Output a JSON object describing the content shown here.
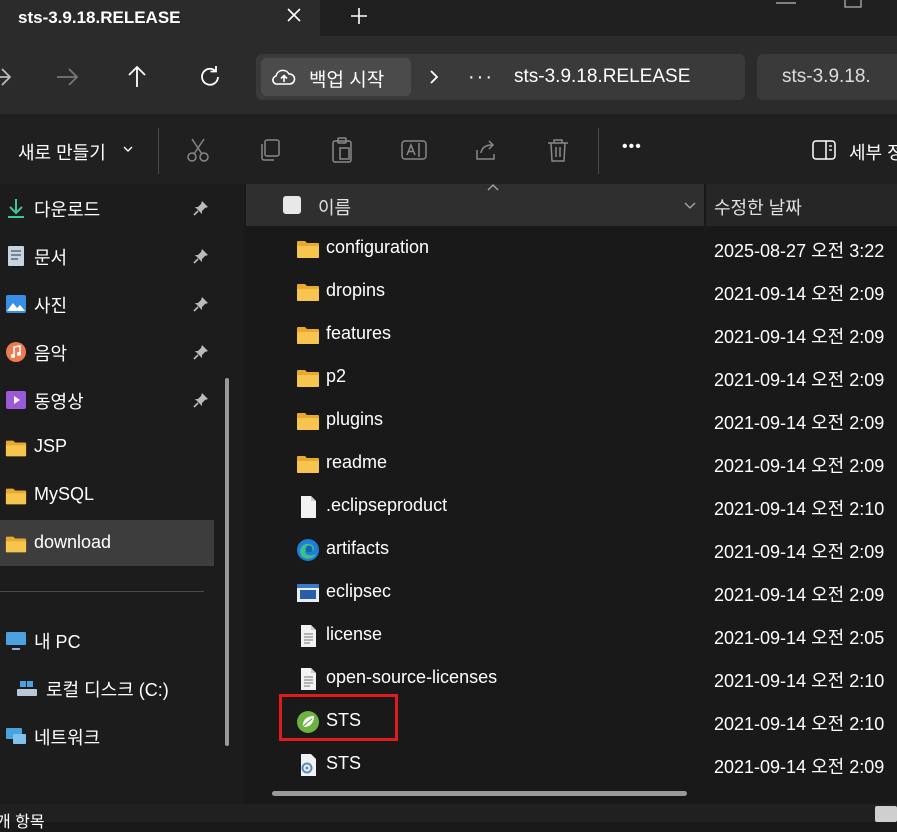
{
  "tab": {
    "title": "sts-3.9.18.RELEASE"
  },
  "address": {
    "backup_label": "백업 시작",
    "more": "···",
    "crumb": "sts-3.9.18.RELEASE",
    "search_placeholder": "sts-3.9.18."
  },
  "toolbar": {
    "new_label": "새로 만들기",
    "more": "•••",
    "details_label": "세부 정"
  },
  "nav": {
    "items": [
      {
        "label": "다운로드",
        "icon": "download-arrow-icon",
        "pinned": true
      },
      {
        "label": "문서",
        "icon": "document-icon",
        "pinned": true
      },
      {
        "label": "사진",
        "icon": "pictures-icon",
        "pinned": true
      },
      {
        "label": "음악",
        "icon": "music-icon",
        "pinned": true
      },
      {
        "label": "동영상",
        "icon": "video-icon",
        "pinned": true
      },
      {
        "label": "JSP",
        "icon": "folder-icon",
        "pinned": false
      },
      {
        "label": "MySQL",
        "icon": "folder-icon",
        "pinned": false
      },
      {
        "label": "download",
        "icon": "folder-icon",
        "pinned": false,
        "selected": true
      }
    ],
    "this_pc": "내 PC",
    "local_disk": "로컬 디스크 (C:)",
    "network": "네트워크"
  },
  "columns": {
    "name": "이름",
    "date": "수정한 날짜"
  },
  "files": [
    {
      "name": "configuration",
      "date": "2025-08-27 오전 3:22",
      "icon": "folder-icon"
    },
    {
      "name": "dropins",
      "date": "2021-09-14 오전 2:09",
      "icon": "folder-icon"
    },
    {
      "name": "features",
      "date": "2021-09-14 오전 2:09",
      "icon": "folder-icon"
    },
    {
      "name": "p2",
      "date": "2021-09-14 오전 2:09",
      "icon": "folder-icon"
    },
    {
      "name": "plugins",
      "date": "2021-09-14 오전 2:09",
      "icon": "folder-icon"
    },
    {
      "name": "readme",
      "date": "2021-09-14 오전 2:09",
      "icon": "folder-icon"
    },
    {
      "name": ".eclipseproduct",
      "date": "2021-09-14 오전 2:10",
      "icon": "file-icon"
    },
    {
      "name": "artifacts",
      "date": "2021-09-14 오전 2:09",
      "icon": "edge-browser-icon"
    },
    {
      "name": "eclipsec",
      "date": "2021-09-14 오전 2:09",
      "icon": "console-app-icon"
    },
    {
      "name": "license",
      "date": "2021-09-14 오전 2:05",
      "icon": "text-file-icon"
    },
    {
      "name": "open-source-licenses",
      "date": "2021-09-14 오전 2:10",
      "icon": "text-file-icon"
    },
    {
      "name": "STS",
      "date": "2021-09-14 오전 2:10",
      "icon": "spring-leaf-icon",
      "highlighted": true
    },
    {
      "name": "STS",
      "date": "2021-09-14 오전 2:09",
      "icon": "config-file-icon"
    }
  ],
  "status": {
    "text": "개 항목"
  },
  "colors": {
    "highlight_border": "#e01b1b",
    "folder": "#f2c04a",
    "spring": "#6db33f"
  }
}
